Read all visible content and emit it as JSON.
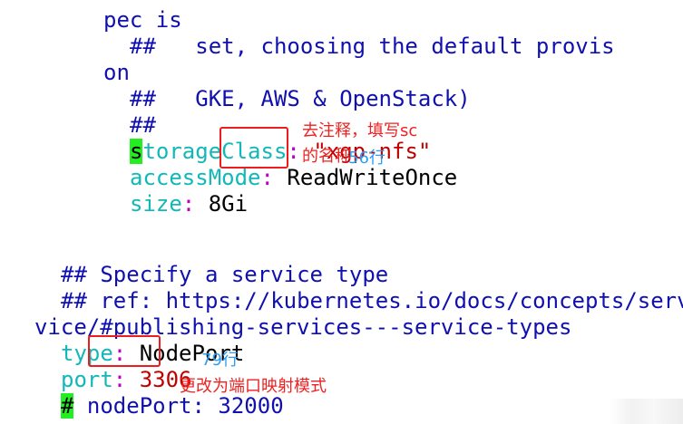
{
  "code_lines": {
    "l0": "pec is",
    "l1": "##   set, choosing the default provis",
    "l2": "on",
    "l3": "##   GKE, AWS & OpenStack)",
    "l4": "##",
    "storage_cursor": "s",
    "storage_key": "torageClass",
    "storage_value": "\"xgp-nfs\"",
    "access_key": "accessMode",
    "access_value": "ReadWriteOnce",
    "size_key": "size",
    "size_value": "8Gi",
    "specify": "## Specify a service type",
    "ref": "## ref: https://kubernetes.io/docs/concepts/serv",
    "ref_wrap": "vice/#publishing-services---service-types",
    "type_key": "type",
    "type_value": "NodePort",
    "port_key": "port",
    "port_value": "3306",
    "nodeport_cursor": "#",
    "nodeport_rest": " nodePort: 32000",
    "colon": ":"
  },
  "annotations": {
    "storage_note_1": "去注释，填写sc",
    "storage_note_2": "的名称",
    "storage_line": "56行",
    "type_line": "79行",
    "type_note": "更改为端口映射模式"
  },
  "colors": {
    "comment": "#1010b0",
    "key": "#12b8b8",
    "value": "#c00000",
    "cursor": "#22ee22",
    "highlight_box": "#ee1c1c",
    "note_red": "#ee2222",
    "note_blue": "#2a9df4"
  }
}
